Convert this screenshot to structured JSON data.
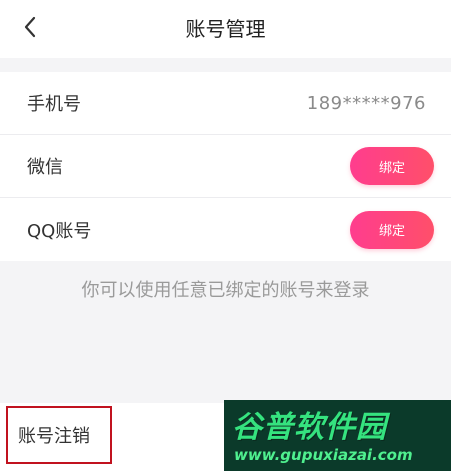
{
  "header": {
    "title": "账号管理",
    "back_icon": "chevron-left-icon"
  },
  "accounts": {
    "phone": {
      "label": "手机号",
      "value": "189*****976"
    },
    "wechat": {
      "label": "微信",
      "button": "绑定"
    },
    "qq": {
      "label": "QQ账号",
      "button": "绑定"
    }
  },
  "hint": "你可以使用任意已绑定的账号来登录",
  "cancel_account": "账号注销",
  "watermark": {
    "title": "谷普软件园",
    "url": "www.gupuxiazai.com"
  },
  "colors": {
    "bind_button": "#ff3d8e",
    "highlight_border": "#c1121f",
    "watermark_bg": "#0b3a2a",
    "watermark_text": "#35e37f"
  }
}
